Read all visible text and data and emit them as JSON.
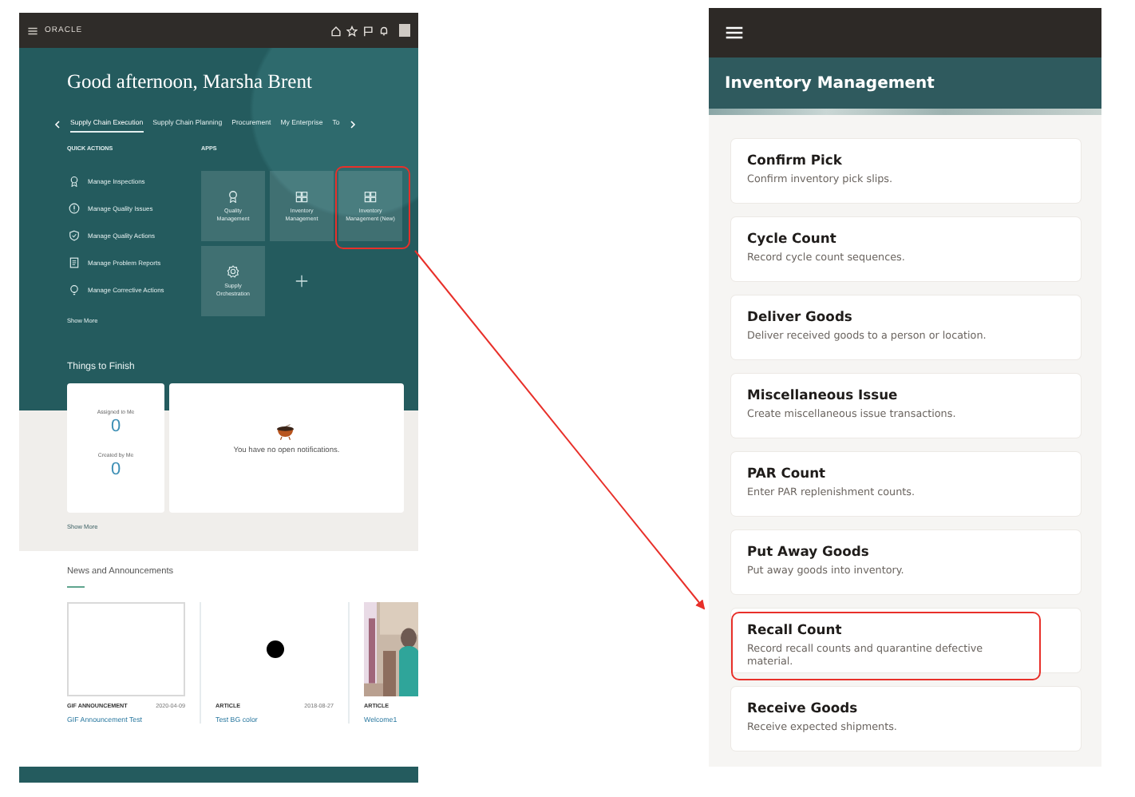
{
  "phone": {
    "brand": "ORACLE",
    "greeting": "Good afternoon, Marsha Brent",
    "tabs": [
      {
        "label": "Supply Chain Execution",
        "selected": true
      },
      {
        "label": "Supply Chain Planning",
        "selected": false
      },
      {
        "label": "Procurement",
        "selected": false
      },
      {
        "label": "My Enterprise",
        "selected": false
      },
      {
        "label": "To",
        "selected": false
      }
    ],
    "quick_actions": {
      "heading": "QUICK ACTIONS",
      "show_more": "Show More",
      "items": [
        {
          "label": "Manage Inspections",
          "kind": "ribbon"
        },
        {
          "label": "Manage Quality Issues",
          "kind": "alert"
        },
        {
          "label": "Manage Quality Actions",
          "kind": "shield"
        },
        {
          "label": "Manage Problem Reports",
          "kind": "document"
        },
        {
          "label": "Manage Corrective Actions",
          "kind": "bulb"
        }
      ]
    },
    "apps": {
      "heading": "APPS",
      "tiles": [
        {
          "label": "Quality Management",
          "kind": "ribbon",
          "highlighted": false
        },
        {
          "label": "Inventory Management",
          "kind": "boxes",
          "highlighted": false
        },
        {
          "label": "Inventory Management (New)",
          "kind": "boxes",
          "highlighted": true
        },
        {
          "label": "Supply Orchestration",
          "kind": "gear",
          "highlighted": false
        }
      ]
    },
    "things_to_finish": {
      "title": "Things to Finish",
      "assigned_label": "Assigned to Me",
      "assigned_count": "0",
      "created_label": "Created by Me",
      "created_count": "0",
      "notifications": "You have no open notifications.",
      "show_more": "Show More"
    },
    "news": {
      "title": "News and Announcements",
      "items": [
        {
          "kind": "blank",
          "type": "GIF ANNOUNCEMENT",
          "date": "2020-04-09",
          "title": "GIF Announcement Test"
        },
        {
          "kind": "dot",
          "type": "ARTICLE",
          "date": "2018-08-27",
          "title": "Test BG color"
        },
        {
          "kind": "picture",
          "type": "ARTICLE",
          "title": "Welcome1"
        }
      ]
    }
  },
  "inventory": {
    "title": "Inventory Management",
    "tasks": [
      {
        "title": "Confirm Pick",
        "description": "Confirm inventory pick slips.",
        "highlighted": false
      },
      {
        "title": "Cycle Count",
        "description": "Record cycle count sequences.",
        "highlighted": false
      },
      {
        "title": "Deliver Goods",
        "description": "Deliver received goods to a person or location.",
        "highlighted": false
      },
      {
        "title": "Miscellaneous Issue",
        "description": "Create miscellaneous issue transactions.",
        "highlighted": false
      },
      {
        "title": "PAR Count",
        "description": "Enter PAR replenishment counts.",
        "highlighted": false
      },
      {
        "title": "Put Away Goods",
        "description": "Put away goods into inventory.",
        "highlighted": false
      },
      {
        "title": "Recall Count",
        "description": "Record recall counts and quarantine defective material.",
        "highlighted": true
      },
      {
        "title": "Receive Goods",
        "description": "Receive expected shipments.",
        "highlighted": false
      }
    ]
  }
}
